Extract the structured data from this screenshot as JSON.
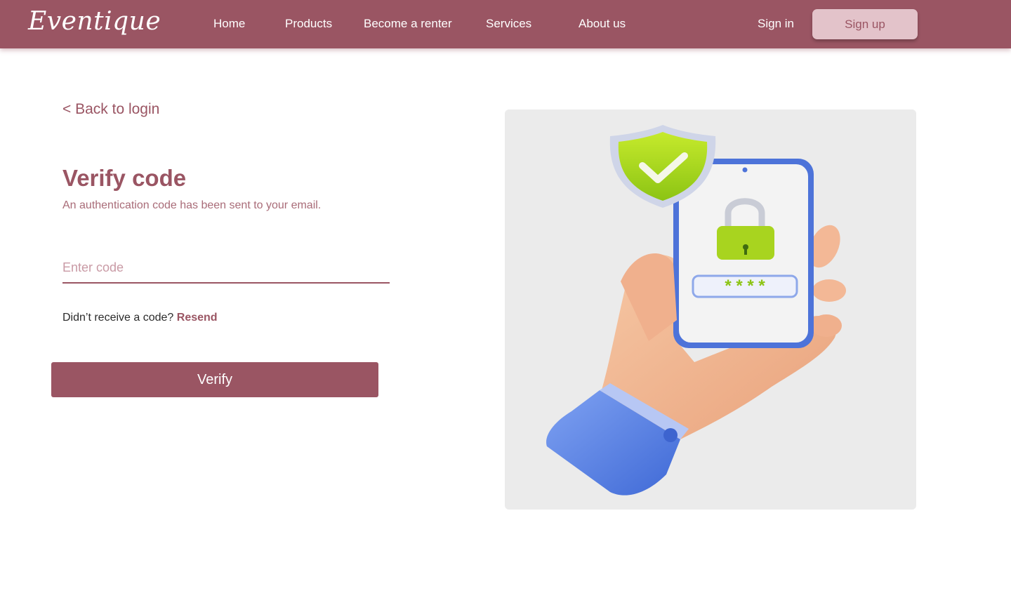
{
  "nav": {
    "logo": "Eventique",
    "links": [
      "Home",
      "Products",
      "Become a renter",
      "Services",
      "About us"
    ],
    "sign_in": "Sign in",
    "sign_up": "Sign up"
  },
  "form": {
    "back_label": "< Back to login",
    "title": "Verify code",
    "subtitle": "An authentication code has been sent to your email.",
    "code_placeholder": "Enter code",
    "code_value": "",
    "resend_prompt": "Didn’t receive a code?",
    "resend_label": "Resend",
    "verify_label": "Verify"
  },
  "illustration": {
    "password_mask": "* * * *",
    "icons": [
      "shield-check-icon",
      "padlock-icon",
      "smartphone-icon",
      "hand-icon"
    ]
  },
  "colors": {
    "brand": "#9a5563",
    "signup_bg": "#e3c3ca",
    "illustration_bg": "#ebebeb",
    "accent_green": "#9fd11a"
  }
}
